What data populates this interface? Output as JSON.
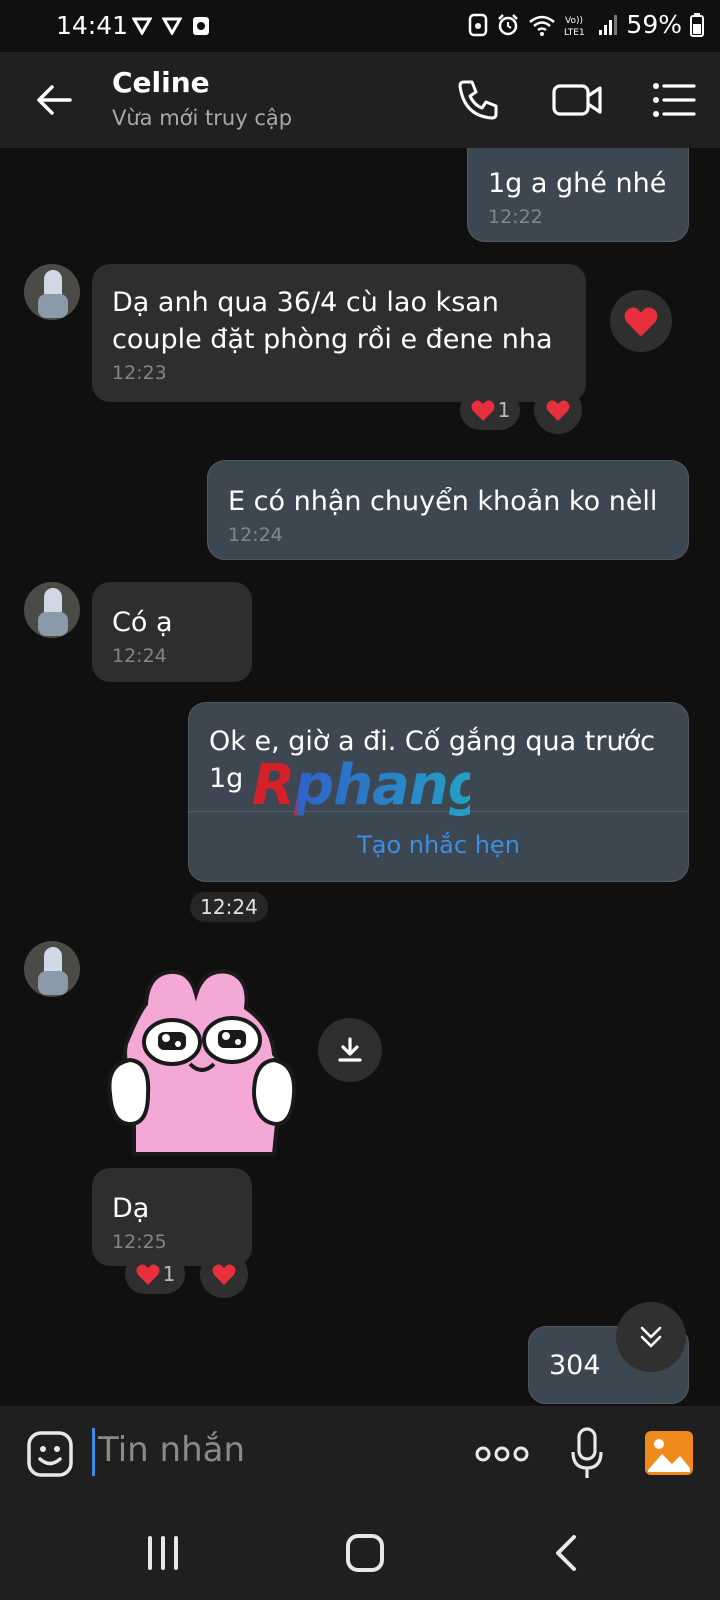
{
  "status_bar": {
    "time": "14:41",
    "battery": "59%",
    "network": "LTE1"
  },
  "header": {
    "contact_name": "Celine",
    "contact_status": "Vừa mới truy cập",
    "icons": [
      "back-arrow-icon",
      "phone-icon",
      "video-call-icon",
      "menu-list-icon"
    ]
  },
  "messages": [
    {
      "direction": "out",
      "text": "1g a ghé nhé",
      "time": "12:22"
    },
    {
      "direction": "in",
      "text_line1": "Dạ anh qua 36/4 cù lao ksan",
      "text_line2": "couple đặt phòng rồi e đene nha",
      "time": "12:23",
      "reaction_count": "1"
    },
    {
      "direction": "out",
      "text": "E có nhận chuyển khoản ko nèll",
      "time": "12:24"
    },
    {
      "direction": "in",
      "text": "Có ạ",
      "time": "12:24"
    },
    {
      "direction": "out",
      "text_line1": "Ok e, giờ a đi. Cố gắng qua trước",
      "text_line2": "1g",
      "action_label": "Tạo nhắc hẹn",
      "time": "12:24"
    },
    {
      "direction": "in",
      "type": "sticker",
      "sticker": "pink-bunny-sticker"
    },
    {
      "direction": "in",
      "text": "Dạ",
      "time": "12:25",
      "reaction_count": "1"
    },
    {
      "direction": "out",
      "text": "304"
    }
  ],
  "watermark": "Rphang",
  "input_bar": {
    "placeholder": "Tin nhắn"
  },
  "colors": {
    "outgoing_bubble": "#3d4751",
    "incoming_bubble": "#2e2e2e",
    "link": "#3a8ee6",
    "heart": "#e8303c"
  }
}
